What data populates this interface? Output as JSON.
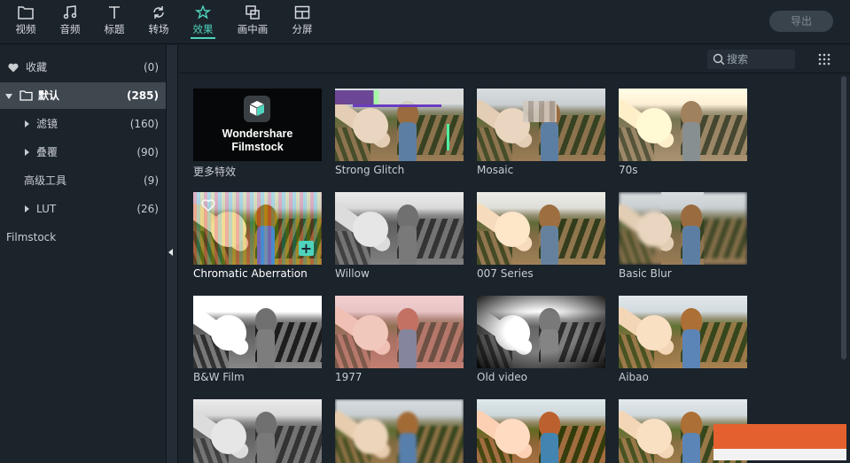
{
  "toolbar": {
    "tabs": [
      {
        "label": "视频",
        "icon": "folder-icon"
      },
      {
        "label": "音频",
        "icon": "music-note-icon"
      },
      {
        "label": "标题",
        "icon": "text-icon"
      },
      {
        "label": "转场",
        "icon": "transition-icon"
      },
      {
        "label": "效果",
        "icon": "effects-icon",
        "active": true
      },
      {
        "label": "画中画",
        "icon": "pip-icon"
      },
      {
        "label": "分屏",
        "icon": "split-screen-icon"
      }
    ],
    "export_label": "导出"
  },
  "sidebar": {
    "items": [
      {
        "label": "收藏",
        "count": "(0)",
        "icon": "heart-icon"
      },
      {
        "label": "默认",
        "count": "(285)",
        "icon": "folder-icon",
        "selected": true
      },
      {
        "label": "滤镜",
        "count": "(160)"
      },
      {
        "label": "叠覆",
        "count": "(90)"
      },
      {
        "label": "高级工具",
        "count": "(9)"
      },
      {
        "label": "LUT",
        "count": "(26)"
      },
      {
        "label": "Filmstock",
        "count": ""
      }
    ]
  },
  "search": {
    "placeholder": "搜索"
  },
  "filmstock_card": {
    "line1": "Wondershare",
    "line2": "Filmstock"
  },
  "effects": [
    "更多特效",
    "Strong Glitch",
    "Mosaic",
    "70s",
    "Chromatic Aberration",
    "Willow",
    "007 Series",
    "Basic Blur",
    "B&W Film",
    "1977",
    "Old video",
    "Aibao",
    "",
    "",
    "",
    ""
  ],
  "colors": {
    "accent": "#4fd3bd",
    "background": "#1b232b",
    "selected": "#3f474f",
    "banner": "#e4612f"
  }
}
